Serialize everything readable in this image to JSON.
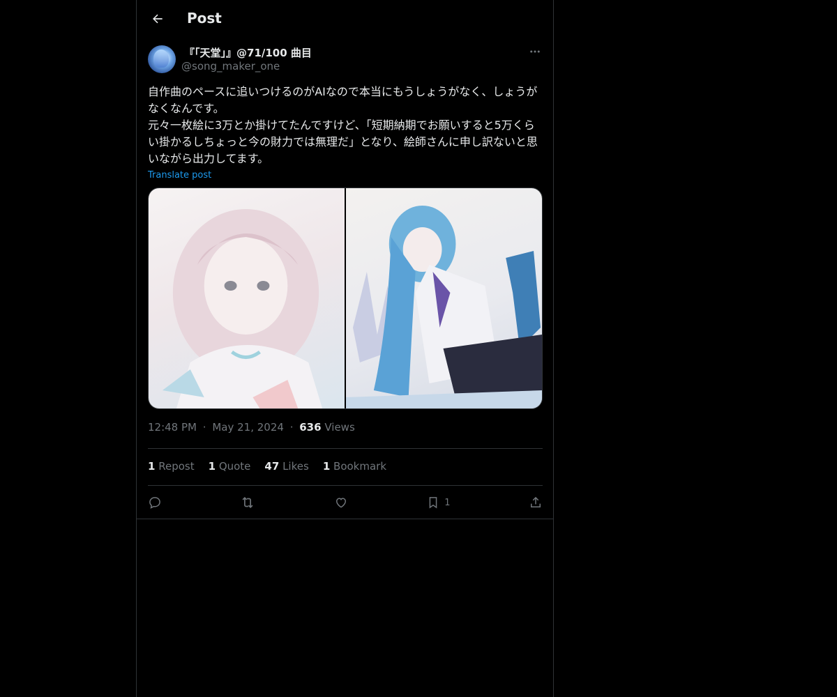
{
  "header": {
    "title": "Post",
    "back_icon": "arrow-left-icon"
  },
  "author": {
    "display_name": "『「天堂」』@71/100 曲目",
    "handle": "@song_maker_one",
    "avatar_icon": "avatar-anime-girl"
  },
  "post": {
    "text": "自作曲のペースに追いつけるのがAIなので本当にもうしょうがなく、しょうがなくなんです。\n元々一枚絵に3万とか掛けてたんですけど、「短期納期でお願いすると5万くらい掛かるしちょっと今の財力では無理だ」となり、絵師さんに申し訳ないと思いながら出力してます。",
    "translate_label": "Translate post",
    "images": [
      {
        "alt_icon": "anime-girl-pink-hair-image"
      },
      {
        "alt_icon": "anime-girl-blue-hair-image"
      }
    ]
  },
  "meta": {
    "time": "12:48 PM",
    "sep1": "·",
    "date": "May 21, 2024",
    "sep2": "·",
    "views_count": "636",
    "views_label": "Views"
  },
  "stats": {
    "reposts_count": "1",
    "reposts_label": "Repost",
    "quotes_count": "1",
    "quotes_label": "Quote",
    "likes_count": "47",
    "likes_label": "Likes",
    "bookmarks_count": "1",
    "bookmarks_label": "Bookmark"
  },
  "actions": {
    "reply_icon": "reply-icon",
    "repost_icon": "repost-icon",
    "like_icon": "heart-icon",
    "bookmark_icon": "bookmark-icon",
    "bookmark_count": "1",
    "share_icon": "share-icon"
  },
  "colors": {
    "background": "#000000",
    "text": "#e7e9ea",
    "muted": "#71767b",
    "accent": "#1d9bf0",
    "border": "#2f3336"
  }
}
